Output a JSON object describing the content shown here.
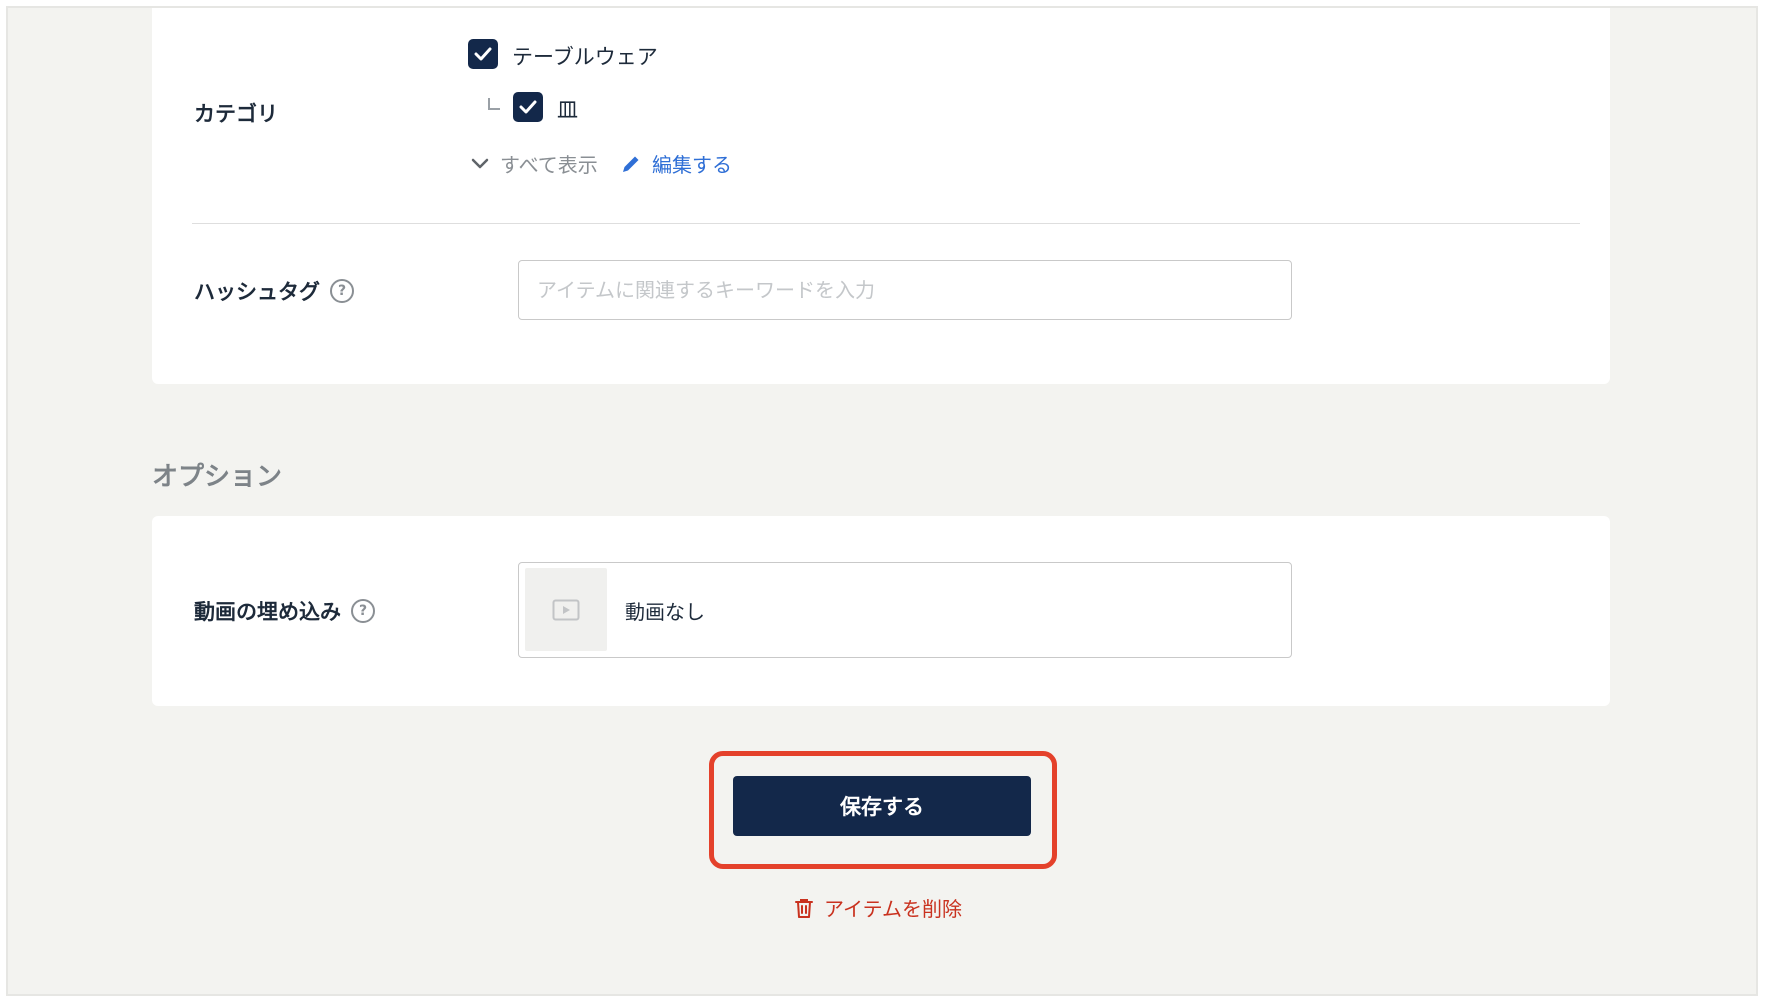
{
  "category": {
    "label": "カテゴリ",
    "items": [
      {
        "label": "テーブルウェア",
        "checked": true
      },
      {
        "label": "皿",
        "checked": true
      }
    ],
    "show_all_label": "すべて表示",
    "edit_label": "編集する"
  },
  "hashtag": {
    "label": "ハッシュタグ",
    "placeholder": "アイテムに関連するキーワードを入力",
    "value": ""
  },
  "options": {
    "heading": "オプション",
    "video_embed": {
      "label": "動画の埋め込み",
      "status": "動画なし"
    }
  },
  "actions": {
    "save_label": "保存する",
    "delete_label": "アイテムを削除"
  },
  "help_icon_glyph": "?",
  "icons": {
    "checkbox": "checkmark-icon",
    "show_all": "chevron-down-icon",
    "edit": "pencil-icon",
    "help": "question-circle-icon",
    "video": "video-icon",
    "delete": "trash-icon"
  },
  "colors": {
    "primary": "#13284a",
    "link": "#2f6fd6",
    "danger": "#c9321f",
    "highlight": "#e4412b",
    "background": "#f3f3f0"
  }
}
